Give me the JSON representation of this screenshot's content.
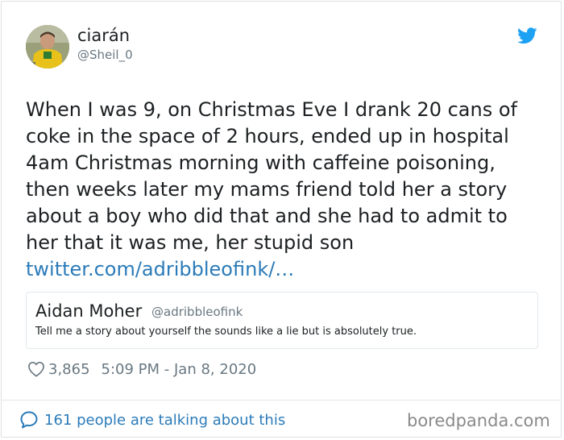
{
  "author": {
    "display_name": "ciarán",
    "handle": "@Sheil_0"
  },
  "tweet": {
    "lines": [
      "When I was 9, on Christmas Eve I drank 20 cans of",
      "coke in the space of 2 hours, ended up in hospital",
      "4am Christmas morning with caffeine poisoning,",
      "then weeks later my mams friend told her a story",
      "about a boy who did that and she had to admit to",
      "her that it was me, her stupid son"
    ],
    "link": "twitter.com/adribbleofink/…"
  },
  "quoted_tweet": {
    "display_name": "Aidan Moher",
    "handle": "@adribbleofink",
    "text": "Tell me a story about yourself the sounds like a lie but is absolutely true."
  },
  "meta": {
    "likes": "3,865",
    "timestamp": "5:09 PM - Jan 8, 2020"
  },
  "footer": {
    "talking_text": "161 people are talking about this"
  },
  "watermark": "boredpanda.com",
  "icons": {
    "brand": "twitter-bird-icon",
    "like": "heart-icon",
    "conversation": "speech-bubble-icon"
  },
  "colors": {
    "twitter_blue": "#1da1f2",
    "link_blue": "#2b7bb9",
    "muted_text": "#697882"
  }
}
